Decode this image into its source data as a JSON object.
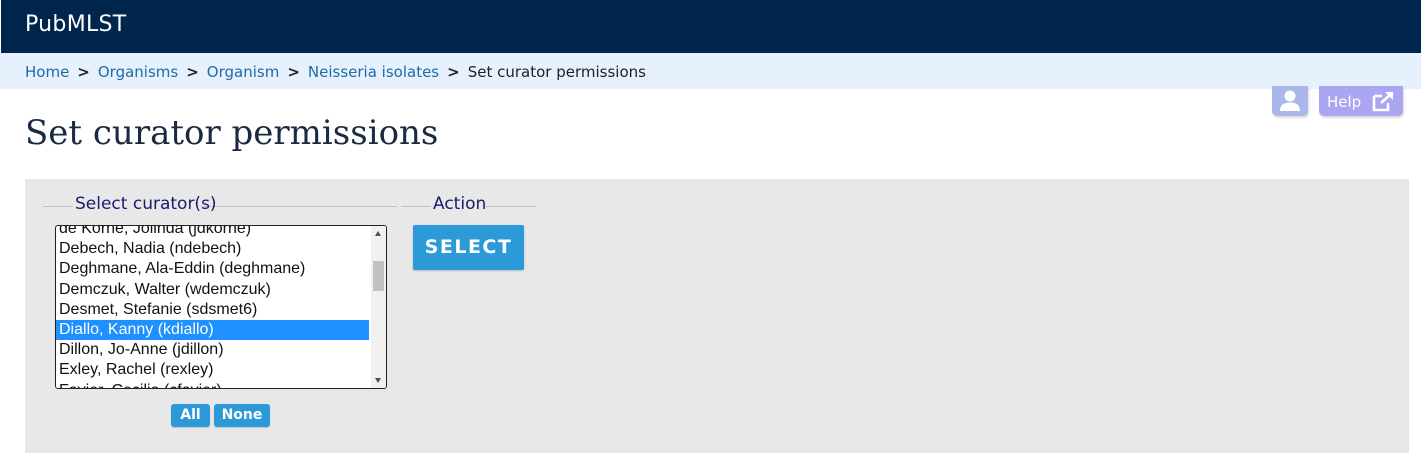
{
  "header": {
    "site_title": "PubMLST",
    "background": "#00264d"
  },
  "breadcrumb": [
    {
      "label": "Home"
    },
    {
      "label": "Organisms"
    },
    {
      "label": "Organism"
    },
    {
      "label": "Neisseria isolates"
    },
    {
      "label": "Set curator permissions"
    }
  ],
  "breadcrumb_separator": ">",
  "page_title": "Set curator permissions",
  "toolbar": {
    "user_icon": "user-icon",
    "help_label": "Help",
    "help_icon": "external-link-icon"
  },
  "curators": {
    "legend": "Select curator(s)",
    "options": [
      "de Korne, Jolinda (jdkorne)",
      "Debech, Nadia (ndebech)",
      "Deghmane, Ala-Eddin (deghmane)",
      "Demczuk, Walter (wdemczuk)",
      "Desmet, Stefanie (sdsmet6)",
      "Diallo, Kanny (kdiallo)",
      "Dillon, Jo-Anne (jdillon)",
      "Exley, Rachel (rexley)",
      "Favier, Cecilia (cfavier)"
    ],
    "selected": "Diallo, Kanny (kdiallo)",
    "all_label": "All",
    "none_label": "None"
  },
  "action": {
    "legend": "Action",
    "select_label": "SELECT"
  },
  "colors": {
    "accent": "#2c9ad8",
    "selected": "#1e90ff",
    "breadcrumb_bg": "#e6f1fd",
    "panel_bg": "#e8e8e8"
  }
}
